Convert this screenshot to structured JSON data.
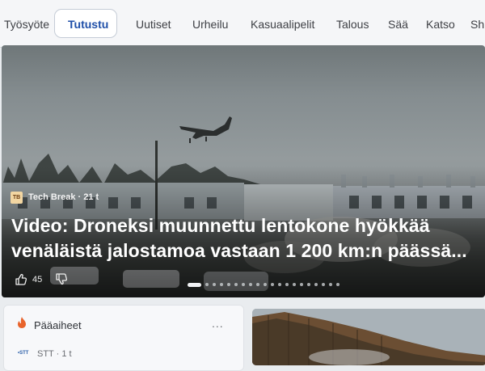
{
  "nav": {
    "tabs": [
      {
        "label": "Työsyöte",
        "active": false
      },
      {
        "label": "Tutustu",
        "active": true
      },
      {
        "label": "Uutiset",
        "active": false
      },
      {
        "label": "Urheilu",
        "active": false
      },
      {
        "label": "Kasuaalipelit",
        "active": false
      },
      {
        "label": "Talous",
        "active": false
      },
      {
        "label": "Sää",
        "active": false
      },
      {
        "label": "Katso",
        "active": false
      },
      {
        "label": "Sh",
        "active": false
      }
    ]
  },
  "hero": {
    "source_logo": "TB",
    "source": "Tech Break · 21 t",
    "headline_line1": "Video: Droneksi muunnettu lentokone hyökkää",
    "headline_line2": "venäläistä jalostamoa vastaan 1 200 km:n päässä...",
    "likes": "45",
    "like_icon": "thumbs-up-icon",
    "dislike_icon": "thumbs-down-icon",
    "carousel_total": 20,
    "carousel_active": 0
  },
  "trending": {
    "title": "Pääaiheet",
    "icon": "flame-icon",
    "more": "...",
    "source_logo": "•STT",
    "source": "STT · 1 t"
  },
  "colors": {
    "accent": "#1f4fa8",
    "flame": "#e8632b"
  }
}
